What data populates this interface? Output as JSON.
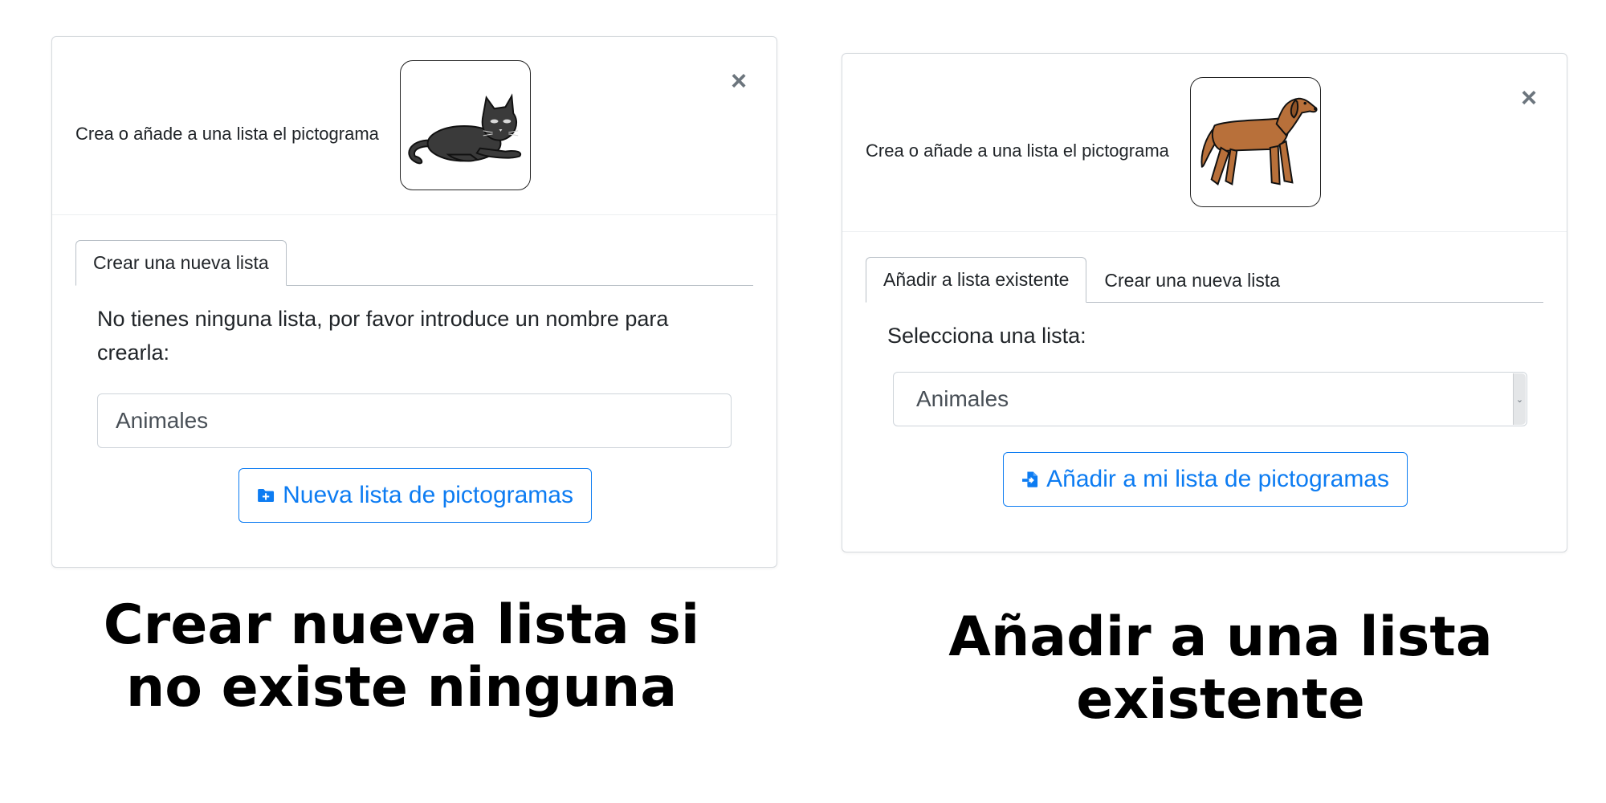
{
  "left_modal": {
    "header_text": "Crea o añade a una lista el pictograma",
    "picto_icon": "cat-icon",
    "close_glyph": "×",
    "tabs": [
      {
        "label": "Crear una nueva lista",
        "active": true
      }
    ],
    "body_text": "No tienes ninguna lista, por favor introduce un nombre para crearla:",
    "input_value": "Animales",
    "button_label": "Nueva lista de pictogramas",
    "button_icon": "folder-plus-icon"
  },
  "right_modal": {
    "header_text": "Crea o añade a una lista el pictograma",
    "picto_icon": "dog-icon",
    "close_glyph": "×",
    "tabs": [
      {
        "label": "Añadir a lista existente",
        "active": true
      },
      {
        "label": "Crear una nueva lista",
        "active": false
      }
    ],
    "body_text": "Selecciona una lista:",
    "select_value": "Animales",
    "button_label": "Añadir a mi lista de pictogramas",
    "button_icon": "file-import-icon"
  },
  "captions": {
    "left": "Crear nueva lista  si no existe ninguna",
    "right": "Añadir a una lista existente"
  },
  "colors": {
    "accent": "#0d7cf2",
    "cat": "#3a3a3a",
    "dog": "#b8703a"
  }
}
